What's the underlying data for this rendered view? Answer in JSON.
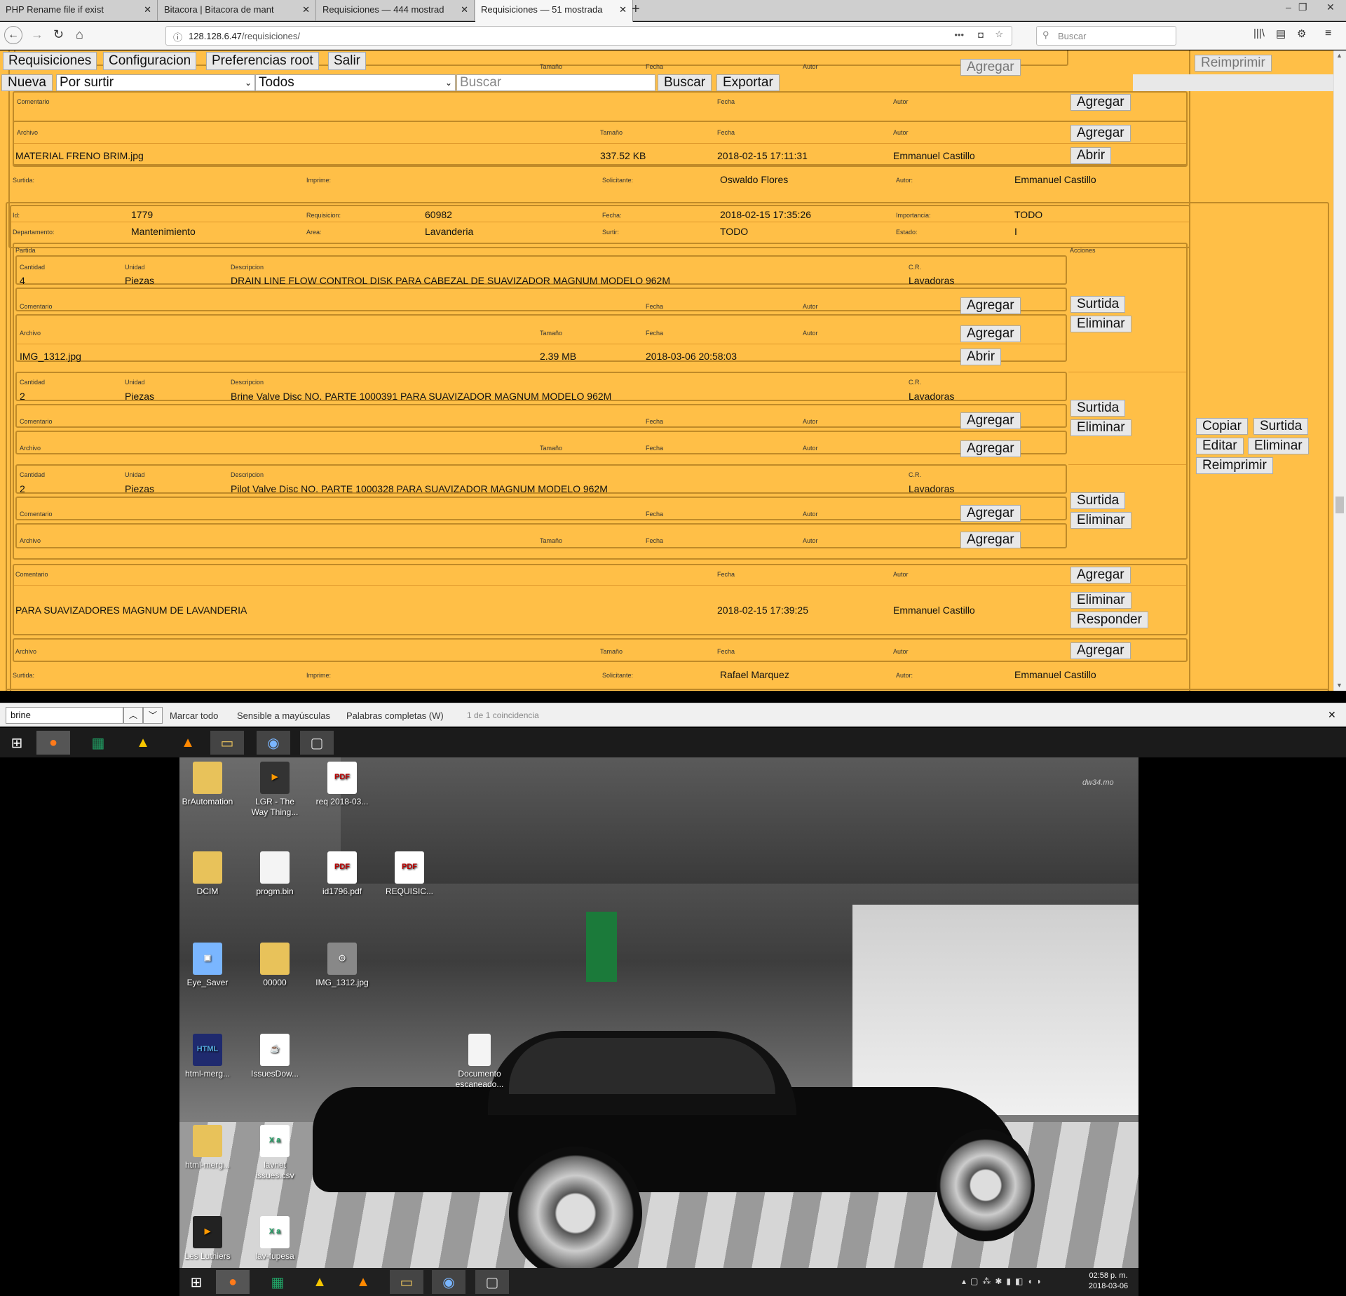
{
  "browser": {
    "tabs": [
      {
        "title": "PHP Rename file if exist"
      },
      {
        "title": "Bitacora | Bitacora de mant"
      },
      {
        "title": "Requisiciones — 444 mostrad"
      },
      {
        "title": "Requisiciones — 51 mostrada"
      }
    ],
    "url_host": "128.128.6.47",
    "url_path": "/requisiciones/",
    "search_placeholder": "Buscar"
  },
  "app": {
    "menu": [
      "Requisiciones",
      "Configuracion",
      "Preferencias root",
      "Salir"
    ],
    "toolbar": {
      "nueva": "Nueva",
      "status_value": "Por surtir",
      "filter_value": "Todos",
      "search_placeholder": "Buscar",
      "buscar": "Buscar",
      "exportar": "Exportar"
    },
    "top_partial": {
      "labels": {
        "tamano": "Tamaño",
        "fecha": "Fecha",
        "autor": "Autor",
        "comentario": "Comentario",
        "archivo": "Archivo",
        "surtida": "Surtida:",
        "imprime": "Imprime:",
        "solicitante": "Solicitante:",
        "autor2": "Autor:"
      },
      "agregar": "Agregar",
      "abrir": "Abrir",
      "reimprimir": "Reimprimir",
      "file": {
        "name": "MATERIAL FRENO BRIM.jpg",
        "size": "337.52 KB",
        "date": "2018-02-15 17:11:31",
        "author": "Emmanuel Castillo"
      },
      "solicitante": "Oswaldo Flores",
      "autor": "Emmanuel Castillo"
    },
    "req": {
      "labels": {
        "id": "Id:",
        "requisicion": "Requisicion:",
        "fecha": "Fecha:",
        "importancia": "Importancia:",
        "departamento": "Departamento:",
        "area": "Area:",
        "surtir": "Surtir:",
        "estado": "Estado:",
        "partida": "Partida",
        "acciones": "Acciones",
        "cantidad": "Cantidad",
        "unidad": "Unidad",
        "descripcion": "Descripcion",
        "cr": "C.R.",
        "comentario": "Comentario",
        "archivo": "Archivo",
        "tamano": "Tamaño",
        "fecha2": "Fecha",
        "autor": "Autor",
        "surtida": "Surtida:",
        "imprime": "Imprime:",
        "solicitante": "Solicitante:",
        "autor2": "Autor:"
      },
      "id": "1779",
      "requisicion": "60982",
      "fecha": "2018-02-15 17:35:26",
      "importancia": "TODO",
      "departamento": "Mantenimiento",
      "area": "Lavanderia",
      "surtir": "TODO",
      "estado": "I",
      "items": [
        {
          "cantidad": "4",
          "unidad": "Piezas",
          "descripcion": "DRAIN LINE FLOW CONTROL DISK PARA CABEZAL DE SUAVIZADOR MAGNUM MODELO 962M",
          "cr": "Lavadoras",
          "file": {
            "name": "IMG_1312.jpg",
            "size": "2.39 MB",
            "date": "2018-03-06 20:58:03"
          }
        },
        {
          "cantidad": "2",
          "unidad": "Piezas",
          "descripcion": "Brine Valve Disc NO. PARTE 1000391 PARA SUAVIZADOR MAGNUM MODELO 962M",
          "cr": "Lavadoras"
        },
        {
          "cantidad": "2",
          "unidad": "Piezas",
          "descripcion": "Pilot Valve Disc NO. PARTE 1000328 PARA SUAVIZADOR MAGNUM MODELO 962M",
          "cr": "Lavadoras"
        }
      ],
      "comment": {
        "text": "PARA SUAVIZADORES MAGNUM DE LAVANDERIA",
        "date": "2018-02-15 17:39:25",
        "author": "Emmanuel Castillo"
      },
      "solicitante": "Rafael Marquez",
      "autor": "Emmanuel Castillo",
      "buttons": {
        "agregar": "Agregar",
        "abrir": "Abrir",
        "surtida": "Surtida",
        "eliminar": "Eliminar",
        "responder": "Responder",
        "copiar": "Copiar",
        "editar": "Editar",
        "reimprimir": "Reimprimir"
      }
    }
  },
  "findbar": {
    "query": "brine",
    "marcar": "Marcar todo",
    "sensible": "Sensible a mayúsculas",
    "palabras": "Palabras completas (W)",
    "result": "1 de 1 coincidencia"
  },
  "desktop": {
    "icons": [
      "BrAutomation",
      "LGR - The Way Thing...",
      "req 2018-03...",
      "DCIM",
      "progm.bin",
      "id1796.pdf",
      "REQUISIC...",
      "Eye_Saver",
      "00000",
      "IMG_1312.jpg",
      "html-merg...",
      "IssuesDow...",
      "Documento escaneado...",
      "html-merg...",
      "lavnet issues.csv",
      "Les Luthiers",
      "lav-fupesa"
    ],
    "watermark": "dw34.mo"
  },
  "clock": {
    "time": "02:58 p. m.",
    "date": "2018-03-06"
  }
}
